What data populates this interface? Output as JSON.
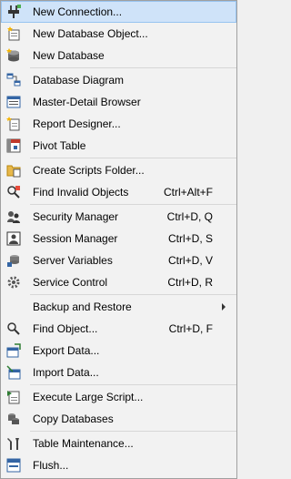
{
  "menu": {
    "items": [
      {
        "label": "New Connection...",
        "shortcut": "",
        "icon": "plug-icon"
      },
      {
        "label": "New Database Object...",
        "shortcut": "",
        "icon": "new-object-icon"
      },
      {
        "label": "New Database",
        "shortcut": "",
        "icon": "new-database-icon"
      },
      {
        "label": "Database Diagram",
        "shortcut": "",
        "icon": "diagram-icon"
      },
      {
        "label": "Master-Detail Browser",
        "shortcut": "",
        "icon": "master-detail-icon"
      },
      {
        "label": "Report Designer...",
        "shortcut": "",
        "icon": "report-icon"
      },
      {
        "label": "Pivot Table",
        "shortcut": "",
        "icon": "pivot-table-icon"
      },
      {
        "label": "Create Scripts Folder...",
        "shortcut": "",
        "icon": "scripts-folder-icon"
      },
      {
        "label": "Find Invalid Objects",
        "shortcut": "Ctrl+Alt+F",
        "icon": "find-invalid-icon"
      },
      {
        "label": "Security Manager",
        "shortcut": "Ctrl+D, Q",
        "icon": "security-icon"
      },
      {
        "label": "Session Manager",
        "shortcut": "Ctrl+D, S",
        "icon": "session-icon"
      },
      {
        "label": "Server Variables",
        "shortcut": "Ctrl+D, V",
        "icon": "server-variables-icon"
      },
      {
        "label": "Service Control",
        "shortcut": "Ctrl+D, R",
        "icon": "service-control-icon"
      },
      {
        "label": "Backup and Restore",
        "shortcut": "",
        "icon": ""
      },
      {
        "label": "Find Object...",
        "shortcut": "Ctrl+D, F",
        "icon": "find-object-icon"
      },
      {
        "label": "Export Data...",
        "shortcut": "",
        "icon": "export-data-icon"
      },
      {
        "label": "Import Data...",
        "shortcut": "",
        "icon": "import-data-icon"
      },
      {
        "label": "Execute Large Script...",
        "shortcut": "",
        "icon": "execute-script-icon"
      },
      {
        "label": "Copy Databases",
        "shortcut": "",
        "icon": "copy-databases-icon"
      },
      {
        "label": "Table Maintenance...",
        "shortcut": "",
        "icon": "table-maintenance-icon"
      },
      {
        "label": "Flush...",
        "shortcut": "",
        "icon": "flush-icon"
      }
    ]
  },
  "colors": {
    "highlight": "#cfe3f9",
    "highlight_border": "#98c4f0",
    "menu_bg": "#f2f2f2"
  }
}
